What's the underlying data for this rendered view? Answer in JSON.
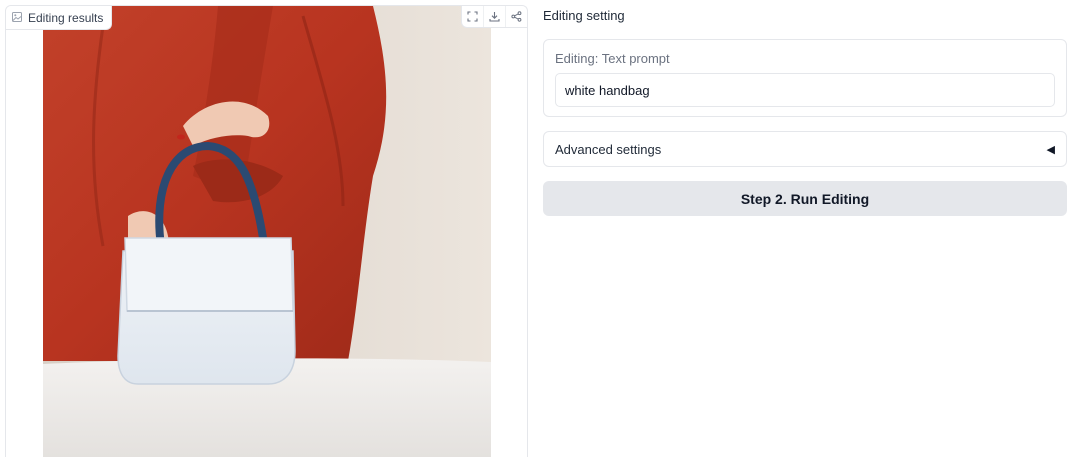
{
  "output_panel": {
    "label": "Editing results",
    "label_icon": "image-icon",
    "toolbar": [
      {
        "name": "fullscreen-icon"
      },
      {
        "name": "download-icon"
      },
      {
        "name": "share-icon"
      }
    ]
  },
  "settings": {
    "title": "Editing setting",
    "prompt": {
      "label": "Editing: Text prompt",
      "value": "white handbag"
    },
    "advanced": {
      "label": "Advanced settings",
      "caret": "◀"
    },
    "run_button": "Step 2. Run Editing"
  }
}
